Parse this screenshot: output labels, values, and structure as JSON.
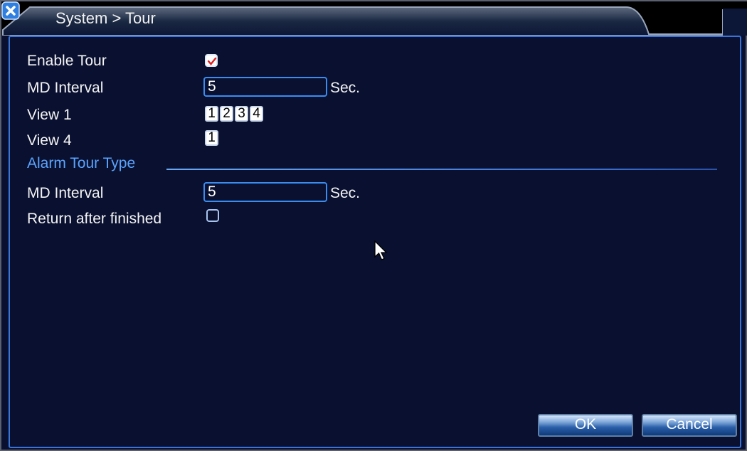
{
  "window": {
    "title": "System > Tour",
    "colors": {
      "background": "#0a1030",
      "accent": "#3a74d8",
      "label_blue": "#5aa4ff",
      "title_icon": "#ff6a1a",
      "close_button": "#2f7fe0"
    }
  },
  "form": {
    "enable_tour": {
      "label": "Enable Tour",
      "checked": true
    },
    "md_interval_top": {
      "label": "MD Interval",
      "value": "5",
      "unit": "Sec."
    },
    "view1": {
      "label": "View 1",
      "items": [
        "1",
        "2",
        "3",
        "4"
      ]
    },
    "view4": {
      "label": "View 4",
      "items": [
        "1"
      ]
    },
    "section_title": "Alarm Tour Type",
    "md_interval_alarm": {
      "label": "MD Interval",
      "value": "5",
      "unit": "Sec."
    },
    "return_after_finished": {
      "label": "Return after finished",
      "checked": false
    }
  },
  "buttons": {
    "ok": "OK",
    "cancel": "Cancel"
  },
  "icons": {
    "title": "orange-circle-icon",
    "close": "close-x-icon",
    "cursor": "mouse-pointer-icon"
  }
}
